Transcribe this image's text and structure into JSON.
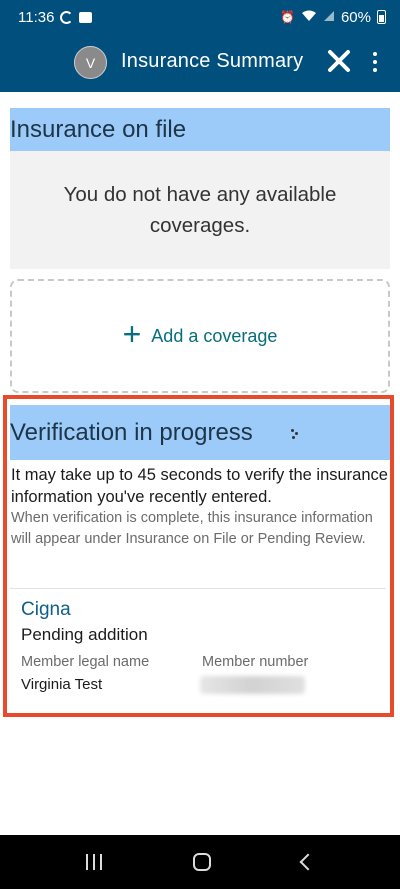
{
  "status_bar": {
    "time": "11:36",
    "battery": "60%"
  },
  "header": {
    "avatar_initial": "V",
    "title": "Insurance Summary"
  },
  "insurance_on_file": {
    "title": "Insurance on file",
    "empty_message": "You do not have any available coverages."
  },
  "add_coverage": {
    "label": "Add a coverage"
  },
  "verification": {
    "title": "Verification in progress",
    "message": "It may take up to 45 seconds to verify the insurance information you've recently entered.",
    "sub_message": "When verification is complete, this insurance information will appear under Insurance on File or Pending Review."
  },
  "pending_card": {
    "insurer": "Cigna",
    "status": "Pending addition",
    "member_name_label": "Member legal name",
    "member_name": "Virginia Test",
    "member_number_label": "Member number"
  },
  "colors": {
    "brand": "#004f7c",
    "section_header": "#9ccbfa",
    "link": "#066f7b",
    "highlight_border": "#e84a2c"
  }
}
